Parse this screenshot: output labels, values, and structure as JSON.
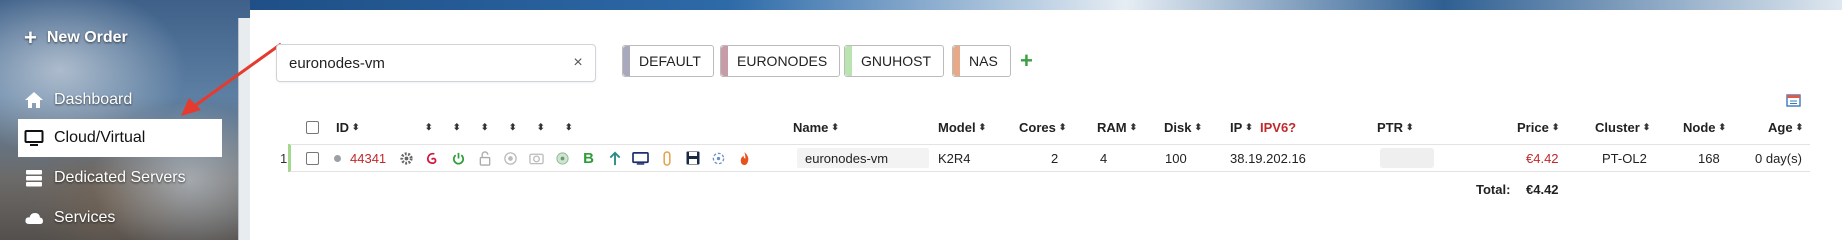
{
  "sidebar": {
    "new_order": "New Order",
    "items": [
      {
        "label": "Dashboard",
        "icon": "home-icon"
      },
      {
        "label": "Cloud/Virtual",
        "icon": "monitor-icon",
        "active": true
      },
      {
        "label": "Dedicated Servers",
        "icon": "server-icon"
      },
      {
        "label": "Services",
        "icon": "cloud-icon"
      }
    ]
  },
  "search": {
    "value": "euronodes-vm",
    "clear": "×"
  },
  "tags": [
    {
      "label": "DEFAULT",
      "color": "#a8a9bd"
    },
    {
      "label": "EURONODES",
      "color": "#c89ba8"
    },
    {
      "label": "GNUHOST",
      "color": "#b9e3b1"
    },
    {
      "label": "NAS",
      "color": "#e6a98a"
    }
  ],
  "add_tag": "+",
  "table": {
    "headers": {
      "id": "ID",
      "name": "Name",
      "model": "Model",
      "cores": "Cores",
      "ram": "RAM",
      "disk": "Disk",
      "ip": "IP",
      "ipv6": "IPV6?",
      "ptr": "PTR",
      "price": "Price",
      "cluster": "Cluster",
      "node": "Node",
      "age": "Age"
    },
    "rows": [
      {
        "num": "1",
        "id": "44341",
        "name": "euronodes-vm",
        "model": "K2R4",
        "cores": "2",
        "ram": "4",
        "disk": "100",
        "ip": "38.19.202.16",
        "ptr": "",
        "price": "€4.42",
        "cluster": "PT-OL2",
        "node": "168",
        "age": "0 day(s)"
      }
    ],
    "total_label": "Total:",
    "total_value": "€4.42"
  },
  "colors": {
    "accent_red": "#c0282b",
    "accent_green": "#3aa040"
  }
}
